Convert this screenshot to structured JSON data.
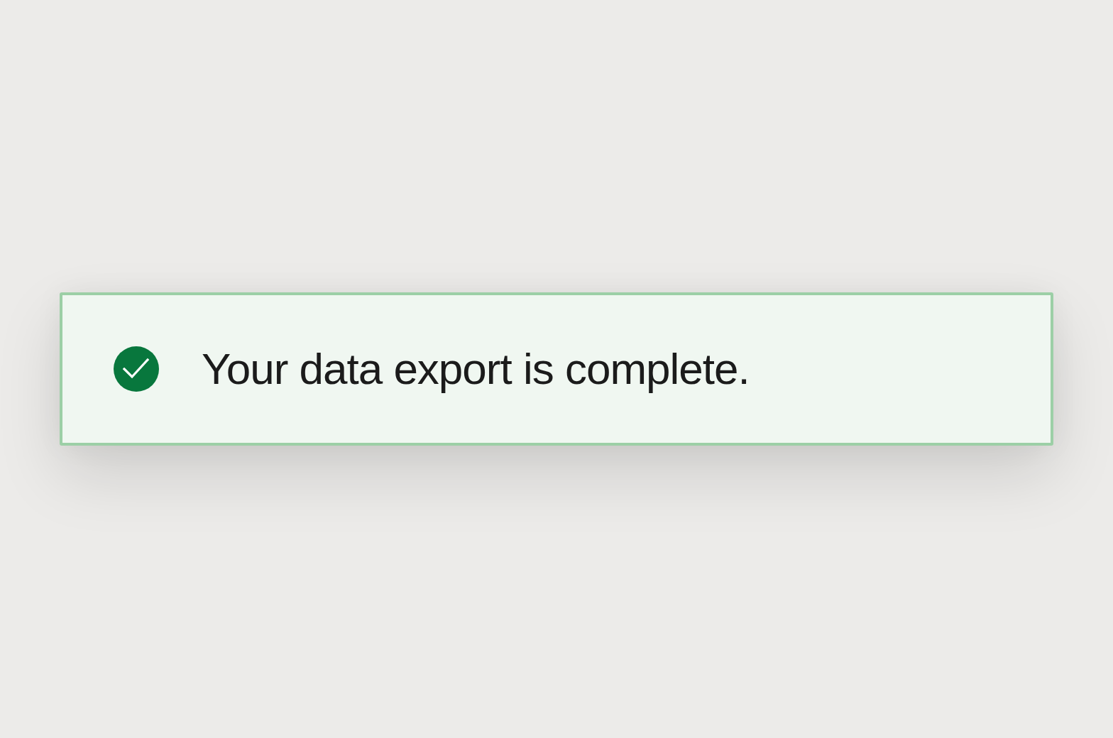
{
  "alert": {
    "kind": "success",
    "message": "Your data export is complete."
  }
}
